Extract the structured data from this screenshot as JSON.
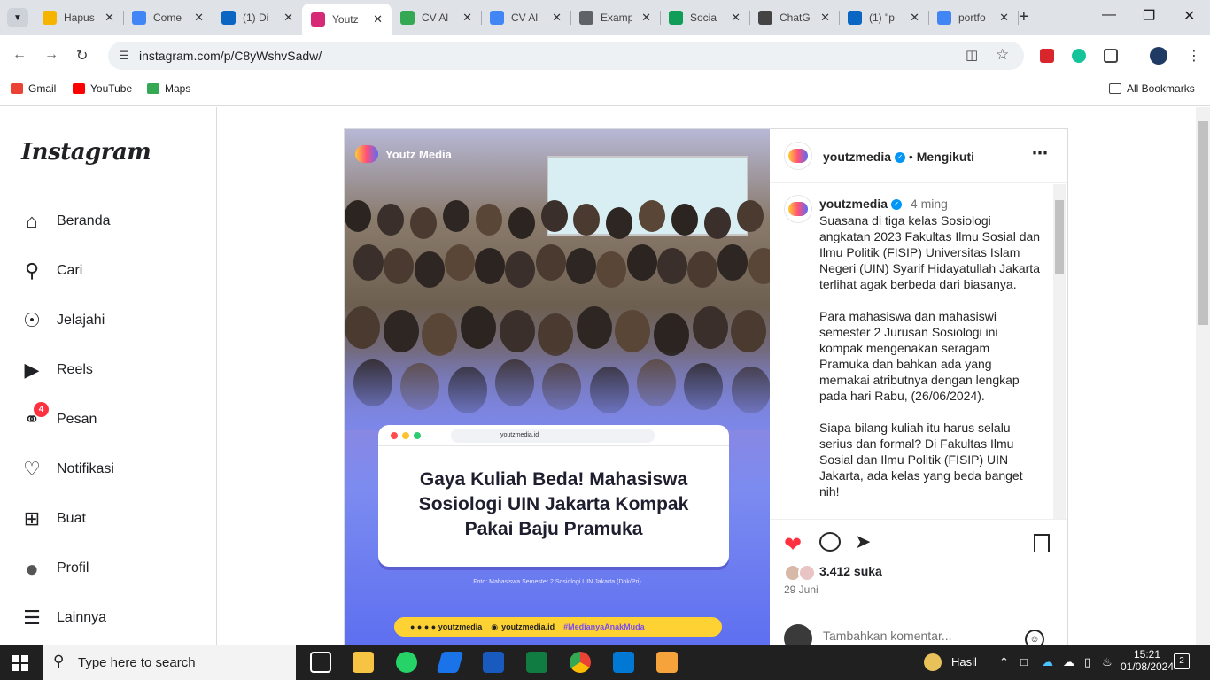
{
  "tabs": [
    {
      "title": "Hapus",
      "color": "#f4b400"
    },
    {
      "title": "Come",
      "color": "#4285f4"
    },
    {
      "title": "(1) Di",
      "color": "#0a66c2"
    },
    {
      "title": "Youtz",
      "color": "#d62976",
      "active": true
    },
    {
      "title": "CV Al",
      "color": "#34a853"
    },
    {
      "title": "CV Al",
      "color": "#4285f4"
    },
    {
      "title": "Examp",
      "color": "#5f6368"
    },
    {
      "title": "Socia",
      "color": "#0f9d58"
    },
    {
      "title": "ChatG",
      "color": "#444444"
    },
    {
      "title": "(1) \"p",
      "color": "#0a66c2"
    },
    {
      "title": "portfo",
      "color": "#4285f4"
    }
  ],
  "address": {
    "url": "instagram.com/p/C8yWshvSadw/"
  },
  "bookmarks": [
    {
      "label": "Gmail",
      "color": "#ea4335"
    },
    {
      "label": "YouTube",
      "color": "#ff0000"
    },
    {
      "label": "Maps",
      "color": "#34a853"
    }
  ],
  "all_bookmarks": "All Bookmarks",
  "instagram": {
    "logo": "Instagram",
    "nav": [
      {
        "label": "Beranda",
        "icon": "home-icon"
      },
      {
        "label": "Cari",
        "icon": "search-icon"
      },
      {
        "label": "Jelajahi",
        "icon": "compass-icon"
      },
      {
        "label": "Reels",
        "icon": "reels-icon"
      },
      {
        "label": "Pesan",
        "icon": "messenger-icon",
        "badge": "4"
      },
      {
        "label": "Notifikasi",
        "icon": "heart-icon"
      },
      {
        "label": "Buat",
        "icon": "plus-square-icon"
      },
      {
        "label": "Profil",
        "icon": "avatar-icon"
      },
      {
        "label": "Lainnya",
        "icon": "menu-icon"
      }
    ]
  },
  "post": {
    "brand": "Youtz Media",
    "browser_url": "youtzmedia.id",
    "headline": "Gaya Kuliah Beda! Mahasiswa Sosiologi UIN Jakarta Kompak Pakai Baju Pramuka",
    "photo_credit": "Foto: Mahasiswa Semester 2 Sosiologi UIN Jakarta (Dok/Pri)",
    "footer_handle1": "youtzmedia",
    "footer_site": "youtzmedia.id",
    "footer_tag": "#MedianyaAnakMuda",
    "username": "youtzmedia",
    "follow_status": "Mengikuti",
    "time_ago": "4 ming",
    "caption": "Suasana di tiga kelas Sosiologi angkatan 2023 Fakultas Ilmu Sosial dan Ilmu Politik (FISIP) Universitas Islam Negeri (UIN) Syarif Hidayatullah Jakarta terlihat agak berbeda dari biasanya.\n\nPara mahasiswa dan mahasiswi semester 2 Jurusan Sosiologi ini kompak mengenakan seragam Pramuka dan bahkan ada yang memakai atributnya dengan lengkap pada hari Rabu, (26/06/2024).\n\nSiapa bilang kuliah itu harus selalu serius dan formal? Di Fakultas Ilmu Sosial dan Ilmu Politik (FISIP) UIN Jakarta, ada kelas yang beda banget nih!\n\nBang Sabar bersama!",
    "likes": "3.412 suka",
    "date": "29 Juni",
    "comment_placeholder": "Tambahkan komentar..."
  },
  "taskbar": {
    "search_placeholder": "Type here to search",
    "weather": "Hasil",
    "time": "15:21",
    "date": "01/08/2024",
    "notifications": "2"
  }
}
